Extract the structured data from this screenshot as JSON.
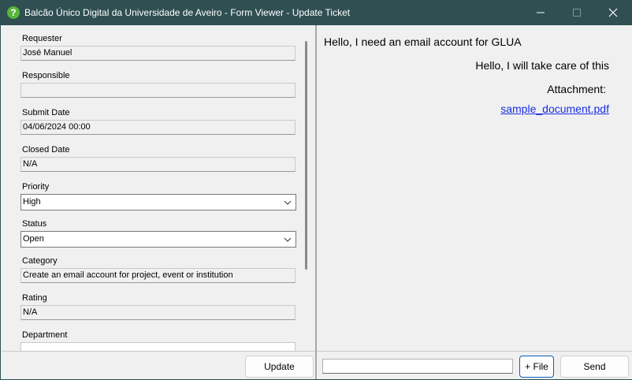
{
  "window": {
    "title": "Balcão Único Digital da Universidade de Aveiro - Form Viewer - Update Ticket",
    "icon_glyph": "?"
  },
  "form": {
    "requester": {
      "label": "Requester",
      "value": "José Manuel"
    },
    "responsible": {
      "label": "Responsible",
      "value": ""
    },
    "submit_date": {
      "label": "Submit Date",
      "value": "04/06/2024 00:00"
    },
    "closed_date": {
      "label": "Closed Date",
      "value": "N/A"
    },
    "priority": {
      "label": "Priority",
      "value": "High"
    },
    "status": {
      "label": "Status",
      "value": "Open"
    },
    "category": {
      "label": "Category",
      "value": "Create an email account for project, event or institution"
    },
    "rating": {
      "label": "Rating",
      "value": "N/A"
    },
    "department": {
      "label": "Department",
      "value": ""
    }
  },
  "chat": {
    "messages": [
      {
        "side": "left",
        "text": "Hello, I need an email account for GLUA"
      },
      {
        "side": "right",
        "text": "Hello, I will take care of this"
      }
    ],
    "attachment_label": "Attachment:",
    "attachment_file": "sample_document.pdf"
  },
  "buttons": {
    "update": "Update",
    "add_file": "+ File",
    "send": "Send"
  },
  "message_input": {
    "value": ""
  },
  "colors": {
    "titlebar": "#2f4f52",
    "app_icon": "#58b53a",
    "link": "#1a2ee6",
    "focus_border": "#0a61b9"
  },
  "icons": [
    "app-help-icon",
    "minimize-icon",
    "maximize-icon",
    "close-icon",
    "chevron-down-icon"
  ]
}
